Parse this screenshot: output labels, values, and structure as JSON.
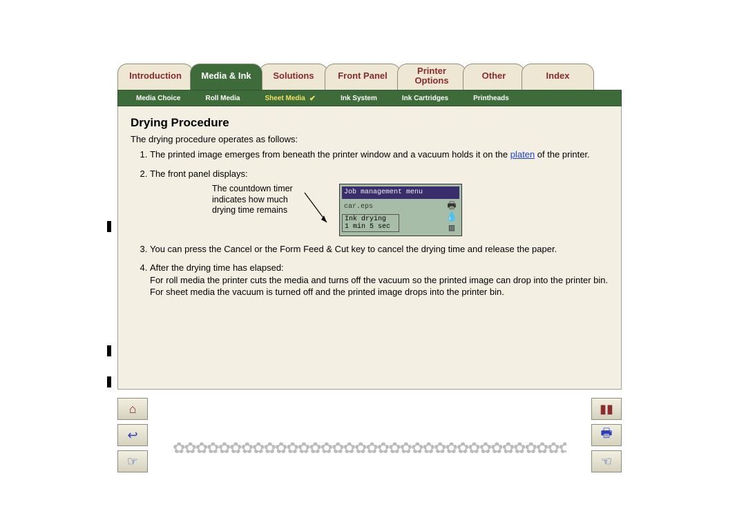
{
  "tabs": {
    "introduction": "Introduction",
    "media_ink": "Media & Ink",
    "solutions": "Solutions",
    "front_panel": "Front Panel",
    "printer_options_l1": "Printer",
    "printer_options_l2": "Options",
    "other": "Other",
    "index": "Index"
  },
  "subtabs": {
    "media_choice": "Media Choice",
    "roll_media": "Roll Media",
    "sheet_media": "Sheet Media",
    "ink_system": "Ink System",
    "ink_cartridges": "Ink Cartridges",
    "printheads": "Printheads",
    "check": "✔"
  },
  "content": {
    "heading": "Drying Procedure",
    "intro": "The drying procedure operates as follows:",
    "step1_pre": "The printed image emerges from beneath the printer window and a vacuum holds it on the ",
    "step1_link": "platen",
    "step1_post": " of the printer.",
    "step2": "The front panel displays:",
    "callout": "The countdown timer indicates how much drying time remains",
    "lcd": {
      "title": "Job management menu",
      "file": "car.eps",
      "status1": "Ink drying",
      "status2": "1 min 5 sec"
    },
    "step3": "You can press the Cancel or the Form Feed & Cut key to cancel the drying time and release the paper.",
    "step4_head": "After the drying time has elapsed:",
    "step4_l1": "For roll media the printer cuts the media and turns off the vacuum so the printed image can drop into the printer bin.",
    "step4_l2": "For sheet media the vacuum is turned off and the printed image drops into the printer bin."
  },
  "nav": {
    "home": "⌂",
    "back": "↩",
    "next": "☞",
    "exit": "▮▮",
    "print": "🖶",
    "prev": "☜"
  }
}
